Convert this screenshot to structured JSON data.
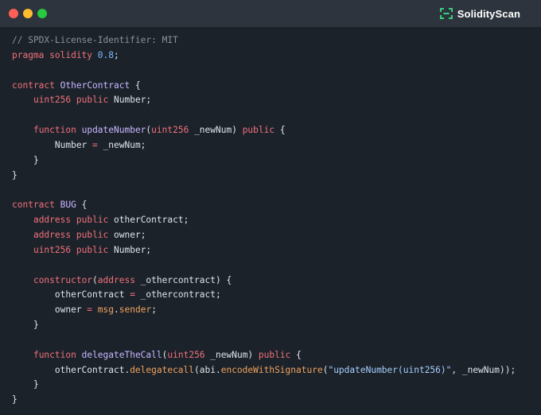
{
  "brand": {
    "name": "SolidityScan",
    "accent": "#34d17b",
    "icon": "bracket-scan-icon"
  },
  "window_controls": {
    "close_color": "#ff5f57",
    "minimize_color": "#febc2e",
    "maximize_color": "#28c840"
  },
  "colors": {
    "background": "#1b222a",
    "titlebar": "#2d343d",
    "comment": "#8a929d",
    "keyword": "#f2717a",
    "number": "#79b8ff",
    "function": "#c9b6ff",
    "plain": "#e0e4ea",
    "string": "#a6d0ff",
    "builtin": "#f0a35e"
  },
  "code_lines": [
    [
      {
        "t": "comment",
        "v": "// SPDX-License-Identifier: MIT"
      }
    ],
    [
      {
        "t": "kw",
        "v": "pragma solidity"
      },
      {
        "t": "plain",
        "v": " "
      },
      {
        "t": "num",
        "v": "0.8"
      },
      {
        "t": "plain",
        "v": ";"
      }
    ],
    [],
    [
      {
        "t": "kw",
        "v": "contract"
      },
      {
        "t": "plain",
        "v": " "
      },
      {
        "t": "func",
        "v": "OtherContract"
      },
      {
        "t": "plain",
        "v": " {"
      }
    ],
    [
      {
        "t": "plain",
        "v": "    "
      },
      {
        "t": "type",
        "v": "uint256"
      },
      {
        "t": "plain",
        "v": " "
      },
      {
        "t": "kw",
        "v": "public"
      },
      {
        "t": "plain",
        "v": " Number;"
      }
    ],
    [],
    [
      {
        "t": "plain",
        "v": "    "
      },
      {
        "t": "kw",
        "v": "function"
      },
      {
        "t": "plain",
        "v": " "
      },
      {
        "t": "func",
        "v": "updateNumber"
      },
      {
        "t": "plain",
        "v": "("
      },
      {
        "t": "type",
        "v": "uint256"
      },
      {
        "t": "plain",
        "v": " _newNum) "
      },
      {
        "t": "kw",
        "v": "public"
      },
      {
        "t": "plain",
        "v": " {"
      }
    ],
    [
      {
        "t": "plain",
        "v": "        Number "
      },
      {
        "t": "kw",
        "v": "="
      },
      {
        "t": "plain",
        "v": " _newNum;"
      }
    ],
    [
      {
        "t": "plain",
        "v": "    }"
      }
    ],
    [
      {
        "t": "plain",
        "v": "}"
      }
    ],
    [],
    [
      {
        "t": "kw",
        "v": "contract"
      },
      {
        "t": "plain",
        "v": " "
      },
      {
        "t": "func",
        "v": "BUG"
      },
      {
        "t": "plain",
        "v": " {"
      }
    ],
    [
      {
        "t": "plain",
        "v": "    "
      },
      {
        "t": "type",
        "v": "address"
      },
      {
        "t": "plain",
        "v": " "
      },
      {
        "t": "kw",
        "v": "public"
      },
      {
        "t": "plain",
        "v": " otherContract;"
      }
    ],
    [
      {
        "t": "plain",
        "v": "    "
      },
      {
        "t": "type",
        "v": "address"
      },
      {
        "t": "plain",
        "v": " "
      },
      {
        "t": "kw",
        "v": "public"
      },
      {
        "t": "plain",
        "v": " owner;"
      }
    ],
    [
      {
        "t": "plain",
        "v": "    "
      },
      {
        "t": "type",
        "v": "uint256"
      },
      {
        "t": "plain",
        "v": " "
      },
      {
        "t": "kw",
        "v": "public"
      },
      {
        "t": "plain",
        "v": " Number;"
      }
    ],
    [],
    [
      {
        "t": "plain",
        "v": "    "
      },
      {
        "t": "kw",
        "v": "constructor"
      },
      {
        "t": "plain",
        "v": "("
      },
      {
        "t": "type",
        "v": "address"
      },
      {
        "t": "plain",
        "v": " _othercontract) {"
      }
    ],
    [
      {
        "t": "plain",
        "v": "        otherContract "
      },
      {
        "t": "kw",
        "v": "="
      },
      {
        "t": "plain",
        "v": " _othercontract;"
      }
    ],
    [
      {
        "t": "plain",
        "v": "        owner "
      },
      {
        "t": "kw",
        "v": "="
      },
      {
        "t": "plain",
        "v": " "
      },
      {
        "t": "builtin",
        "v": "msg"
      },
      {
        "t": "plain",
        "v": "."
      },
      {
        "t": "builtin",
        "v": "sender"
      },
      {
        "t": "plain",
        "v": ";"
      }
    ],
    [
      {
        "t": "plain",
        "v": "    }"
      }
    ],
    [],
    [
      {
        "t": "plain",
        "v": "    "
      },
      {
        "t": "kw",
        "v": "function"
      },
      {
        "t": "plain",
        "v": " "
      },
      {
        "t": "func",
        "v": "delegateTheCall"
      },
      {
        "t": "plain",
        "v": "("
      },
      {
        "t": "type",
        "v": "uint256"
      },
      {
        "t": "plain",
        "v": " _newNum) "
      },
      {
        "t": "kw",
        "v": "public"
      },
      {
        "t": "plain",
        "v": " {"
      }
    ],
    [
      {
        "t": "plain",
        "v": "        otherContract."
      },
      {
        "t": "builtin",
        "v": "delegatecall"
      },
      {
        "t": "plain",
        "v": "("
      },
      {
        "t": "plain",
        "v": "abi."
      },
      {
        "t": "builtin",
        "v": "encodeWithSignature"
      },
      {
        "t": "plain",
        "v": "("
      },
      {
        "t": "string",
        "v": "\"updateNumber(uint256)\""
      },
      {
        "t": "plain",
        "v": ", _newNum));"
      }
    ],
    [
      {
        "t": "plain",
        "v": "    }"
      }
    ],
    [
      {
        "t": "plain",
        "v": "}"
      }
    ]
  ]
}
